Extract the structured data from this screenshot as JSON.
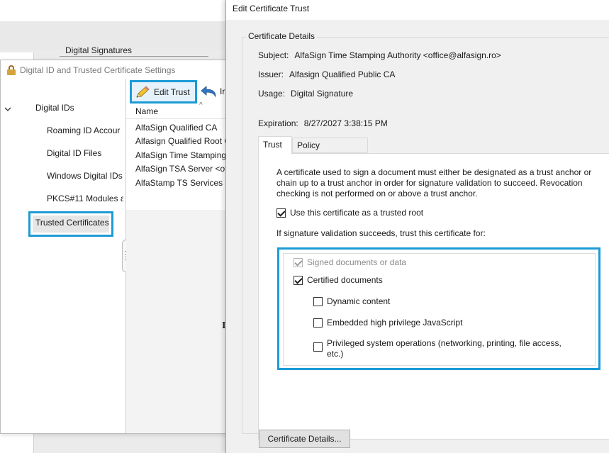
{
  "background": {
    "section_label": "Digital Signatures"
  },
  "id_window": {
    "title": "Digital ID and Trusted Certificate Settings",
    "tree": {
      "root": "Digital IDs",
      "items": [
        "Roaming ID Accour",
        "Digital ID Files",
        "Windows Digital IDs",
        "PKCS#11 Modules a"
      ],
      "selected": "Trusted Certificates"
    },
    "toolbar": {
      "edit_trust": "Edit Trust",
      "import_partial": "Ir"
    },
    "list": {
      "column_name": "Name",
      "rows": [
        "AlfaSign Qualified CA",
        "Alfasign Qualified Root C",
        "AlfaSign Time Stamping",
        "AlfaSign TSA Server <off",
        "AlfaStamp TS Services"
      ]
    },
    "cut_text": "I"
  },
  "dialog": {
    "title": "Edit Certificate Trust",
    "group_label": "Certificate Details",
    "subject_key": "Subject:",
    "subject_value": "AlfaSign Time Stamping Authority <office@alfasign.ro>",
    "issuer_key": "Issuer:",
    "issuer_value": "Alfasign Qualified Public CA",
    "usage_key": "Usage:",
    "usage_value": "Digital Signature",
    "expiration_key": "Expiration:",
    "expiration_value": "8/27/2027 3:38:15 PM",
    "tabs": [
      "Trust",
      "Policy Restrictions"
    ],
    "active_tab": "Trust",
    "description": "A certificate used to sign a document must either be designated as a trust anchor or chain up to a trust anchor in order for signature validation to succeed.  Revocation checking is not performed on or above a trust anchor.",
    "use_trusted_root": {
      "label": "Use this certificate as a trusted root",
      "checked": true
    },
    "trust_for_label": "If signature validation succeeds, trust this certificate for:",
    "options": {
      "signed_documents": {
        "label": "Signed documents or data",
        "checked": true,
        "disabled": true
      },
      "certified_documents": {
        "label": "Certified documents",
        "checked": true
      },
      "dynamic_content": {
        "label": "Dynamic content",
        "checked": false
      },
      "embedded_js": {
        "label": "Embedded high privilege JavaScript",
        "checked": false
      },
      "privileged_ops": {
        "label": "Privileged system operations (networking, printing, file access, etc.)",
        "checked": false
      },
      "privileged_ops_line1": "Privileged system operations (networking, printing, file access,",
      "privileged_ops_line2": "etc.)"
    },
    "certificate_details_button": "Certificate Details..."
  },
  "colors": {
    "highlight": "#1c9bd6",
    "dialog_bg": "#f0f0f0"
  }
}
